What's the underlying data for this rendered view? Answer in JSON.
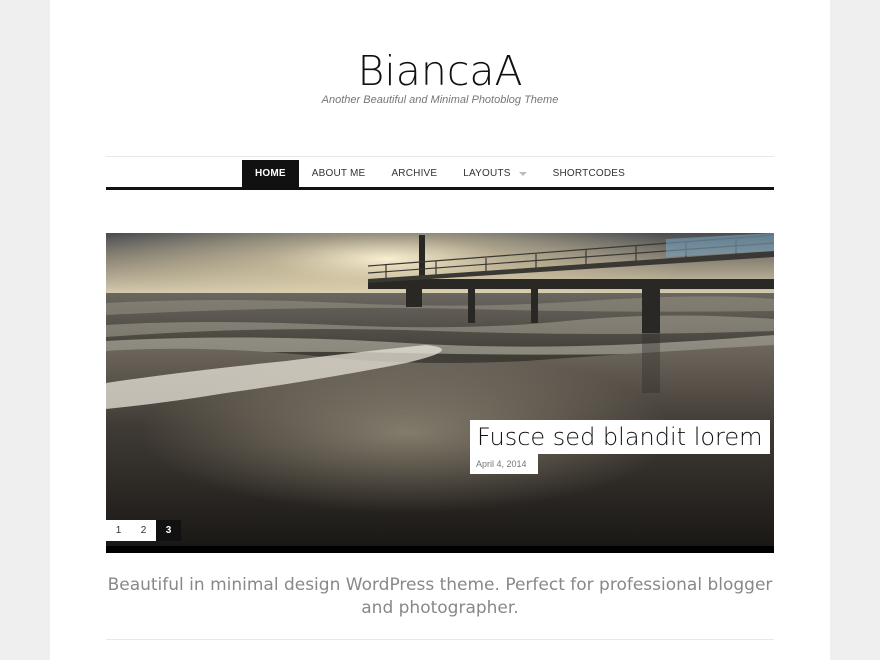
{
  "site": {
    "title": "BiancaA",
    "tagline": "Another Beautiful and Minimal Photoblog Theme"
  },
  "nav": {
    "items": [
      {
        "label": "HOME",
        "active": true
      },
      {
        "label": "ABOUT ME"
      },
      {
        "label": "ARCHIVE"
      },
      {
        "label": "LAYOUTS",
        "has_dropdown": true
      },
      {
        "label": "SHORTCODES"
      }
    ]
  },
  "slider": {
    "caption_title": "Fusce sed blandit lorem",
    "caption_date": "April 4, 2014",
    "image_icon": "pier-beach-sunset-photo",
    "pages": [
      "1",
      "2",
      "3"
    ],
    "active_page": "3"
  },
  "intro": {
    "text": "Beautiful in minimal design WordPress theme. Perfect for professional blogger and photographer."
  },
  "colors": {
    "background": "#efefef",
    "page": "#ffffff",
    "accent": "#111111"
  }
}
